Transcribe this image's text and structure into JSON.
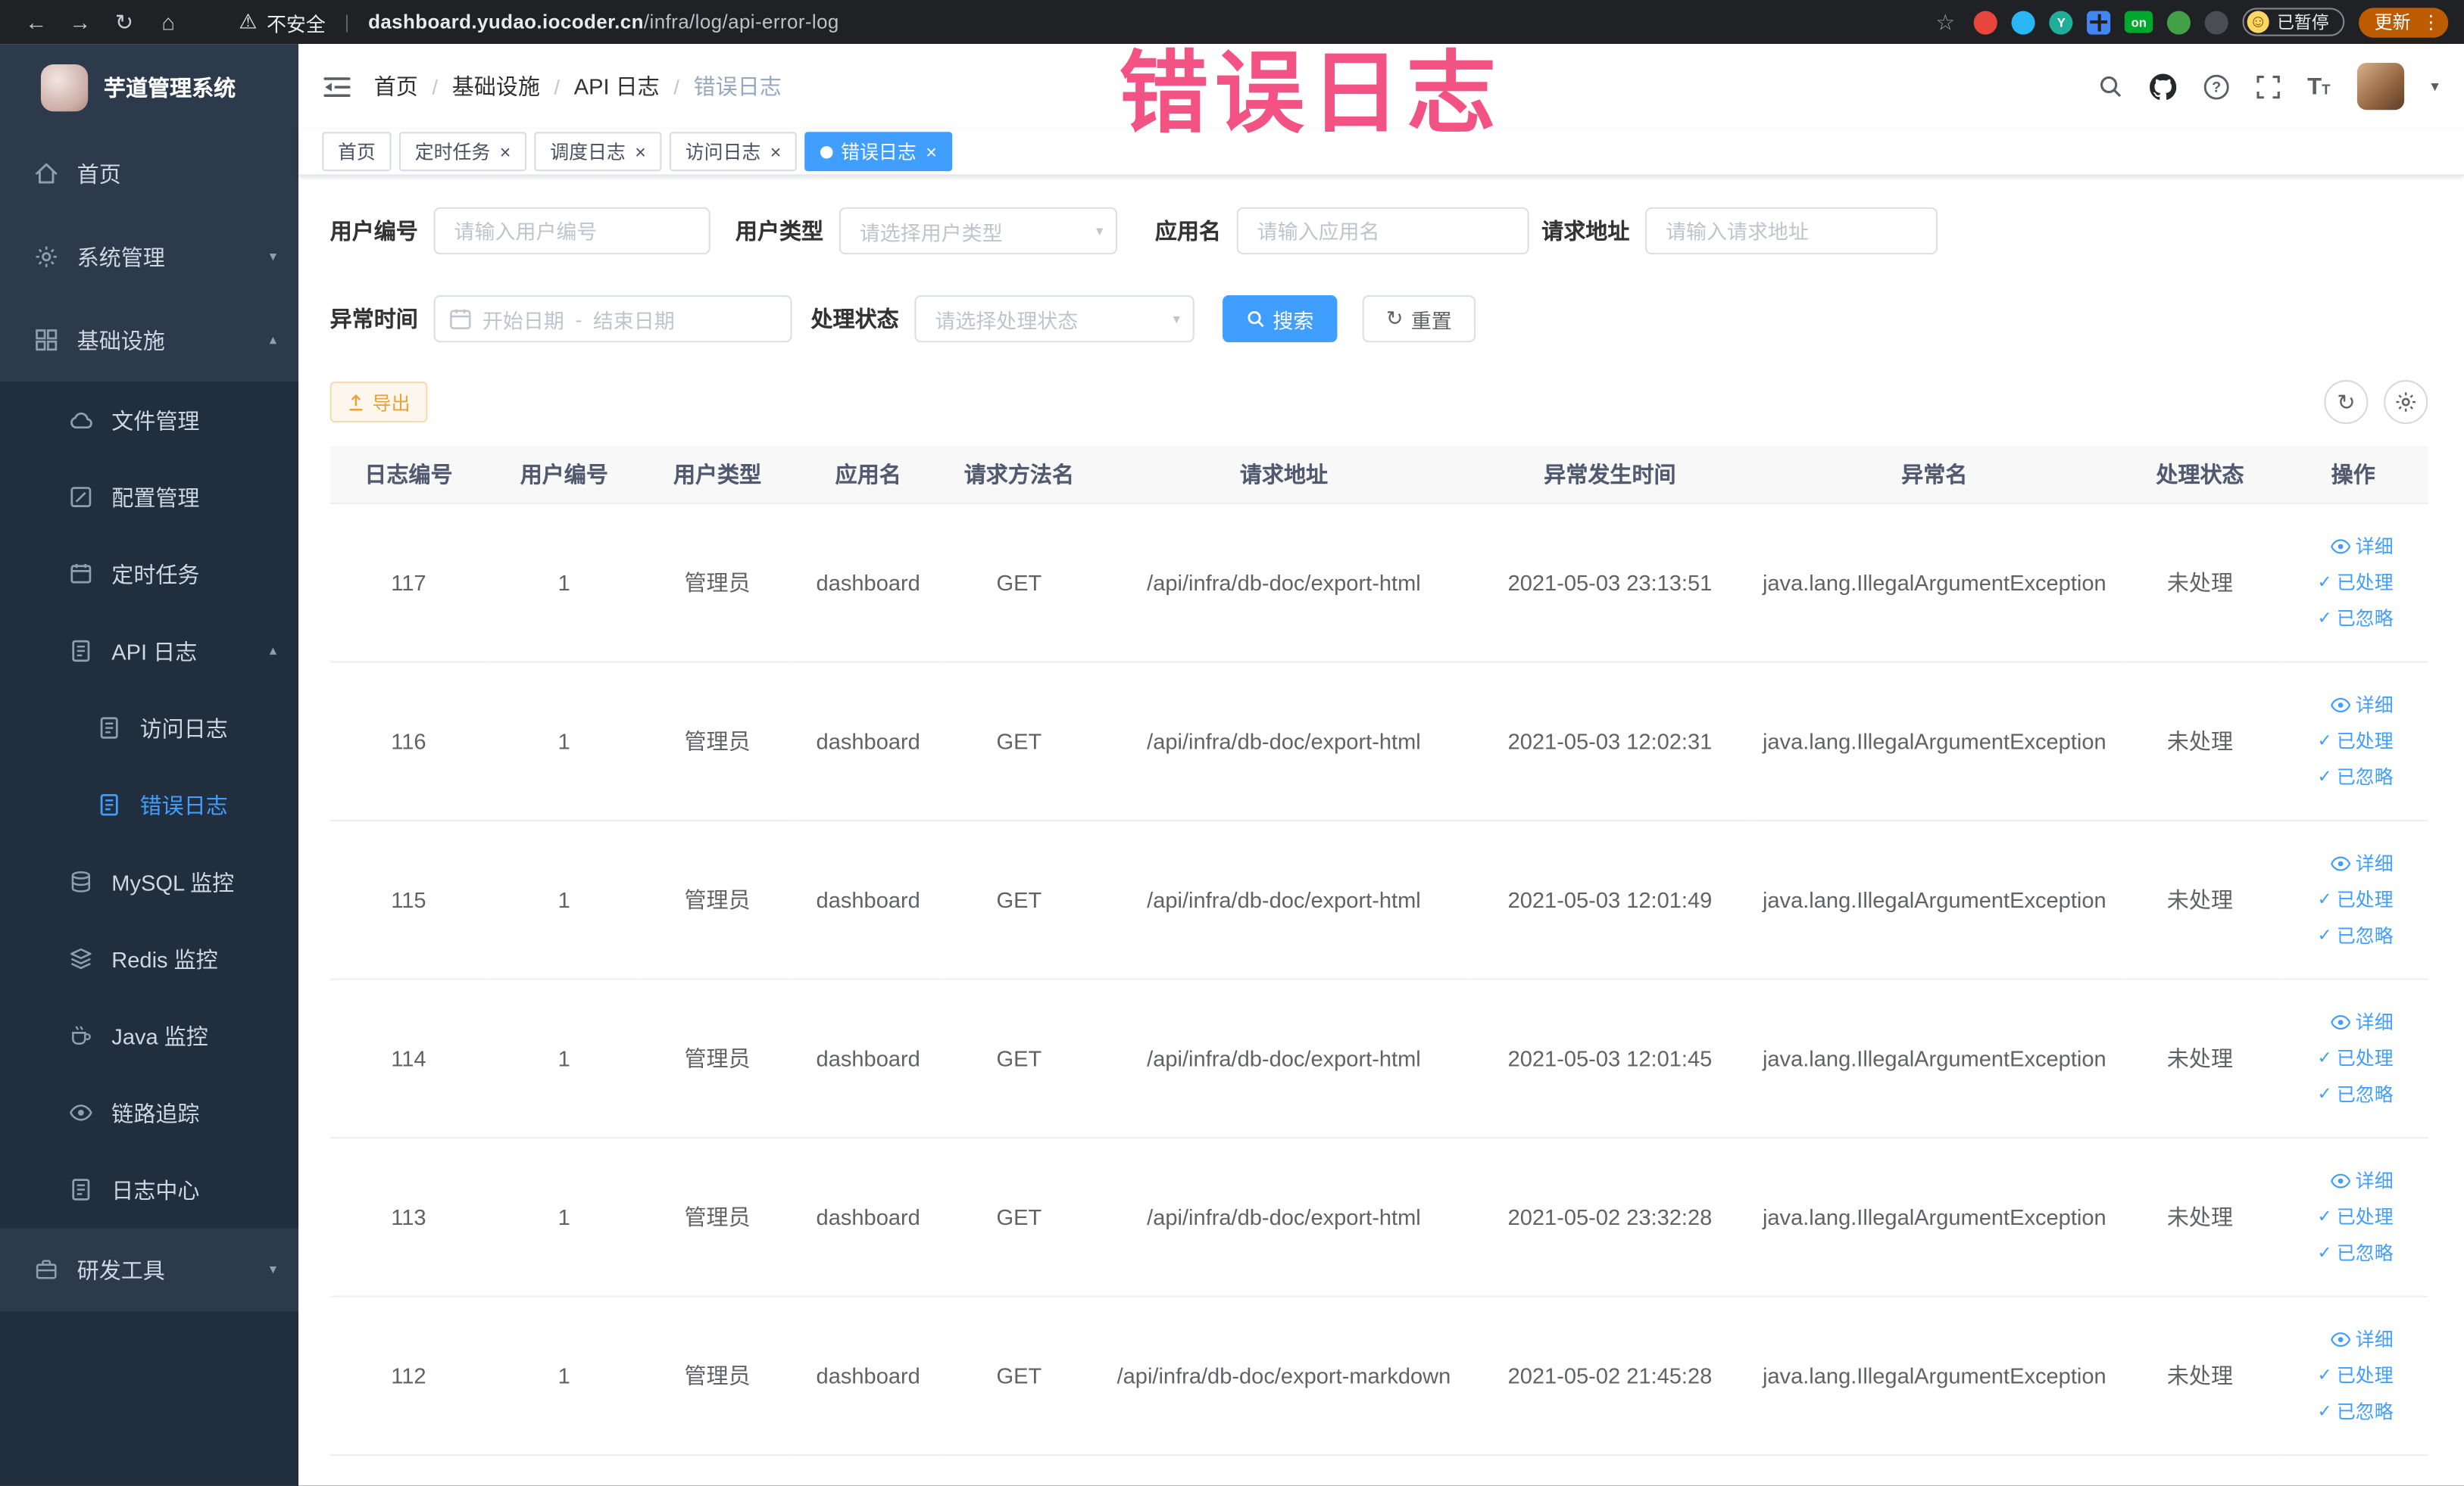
{
  "browser": {
    "security_label": "不安全",
    "url_domain": "dashboard.yudao.iocoder.cn",
    "url_path": "/infra/log/api-error-log",
    "ext_on_badge": "on",
    "paused_badge": "已暂停",
    "update_button": "更新"
  },
  "watermark": "错误日志",
  "sidebar": {
    "app_title": "芋道管理系统",
    "items": [
      {
        "label": "首页"
      },
      {
        "label": "系统管理"
      },
      {
        "label": "基础设施"
      },
      {
        "label": "文件管理"
      },
      {
        "label": "配置管理"
      },
      {
        "label": "定时任务"
      },
      {
        "label": "API 日志"
      },
      {
        "label": "访问日志"
      },
      {
        "label": "错误日志"
      },
      {
        "label": "MySQL 监控"
      },
      {
        "label": "Redis 监控"
      },
      {
        "label": "Java 监控"
      },
      {
        "label": "链路追踪"
      },
      {
        "label": "日志中心"
      },
      {
        "label": "研发工具"
      }
    ]
  },
  "header": {
    "breadcrumb": [
      {
        "label": "首页"
      },
      {
        "label": "基础设施"
      },
      {
        "label": "API 日志"
      },
      {
        "label": "错误日志"
      }
    ]
  },
  "tabs": [
    {
      "label": "首页"
    },
    {
      "label": "定时任务"
    },
    {
      "label": "调度日志"
    },
    {
      "label": "访问日志"
    },
    {
      "label": "错误日志"
    }
  ],
  "filters": {
    "user_id_label": "用户编号",
    "user_id_placeholder": "请输入用户编号",
    "user_type_label": "用户类型",
    "user_type_placeholder": "请选择用户类型",
    "app_name_label": "应用名",
    "app_name_placeholder": "请输入应用名",
    "request_url_label": "请求地址",
    "request_url_placeholder": "请输入请求地址",
    "exception_time_label": "异常时间",
    "date_start_placeholder": "开始日期",
    "date_separator": "-",
    "date_end_placeholder": "结束日期",
    "process_status_label": "处理状态",
    "process_status_placeholder": "请选择处理状态",
    "search_button": "搜索",
    "reset_button": "重置"
  },
  "toolbar": {
    "export_button": "导出"
  },
  "table": {
    "headers": [
      "日志编号",
      "用户编号",
      "用户类型",
      "应用名",
      "请求方法名",
      "请求地址",
      "异常发生时间",
      "异常名",
      "处理状态",
      "操作"
    ],
    "action_labels": {
      "detail": "详细",
      "processed": "已处理",
      "ignore": "已忽略"
    },
    "rows": [
      {
        "log_id": "117",
        "user_id": "1",
        "user_type": "管理员",
        "app_name": "dashboard",
        "method": "GET",
        "request_url": "/api/infra/db-doc/export-html",
        "exception_time": "2021-05-03 23:13:51",
        "exception_name": "java.lang.IllegalArgumentException",
        "status": "未处理"
      },
      {
        "log_id": "116",
        "user_id": "1",
        "user_type": "管理员",
        "app_name": "dashboard",
        "method": "GET",
        "request_url": "/api/infra/db-doc/export-html",
        "exception_time": "2021-05-03 12:02:31",
        "exception_name": "java.lang.IllegalArgumentException",
        "status": "未处理"
      },
      {
        "log_id": "115",
        "user_id": "1",
        "user_type": "管理员",
        "app_name": "dashboard",
        "method": "GET",
        "request_url": "/api/infra/db-doc/export-html",
        "exception_time": "2021-05-03 12:01:49",
        "exception_name": "java.lang.IllegalArgumentException",
        "status": "未处理"
      },
      {
        "log_id": "114",
        "user_id": "1",
        "user_type": "管理员",
        "app_name": "dashboard",
        "method": "GET",
        "request_url": "/api/infra/db-doc/export-html",
        "exception_time": "2021-05-03 12:01:45",
        "exception_name": "java.lang.IllegalArgumentException",
        "status": "未处理"
      },
      {
        "log_id": "113",
        "user_id": "1",
        "user_type": "管理员",
        "app_name": "dashboard",
        "method": "GET",
        "request_url": "/api/infra/db-doc/export-html",
        "exception_time": "2021-05-02 23:32:28",
        "exception_name": "java.lang.IllegalArgumentException",
        "status": "未处理"
      },
      {
        "log_id": "112",
        "user_id": "1",
        "user_type": "管理员",
        "app_name": "dashboard",
        "method": "GET",
        "request_url": "/api/infra/db-doc/export-markdown",
        "exception_time": "2021-05-02 21:45:28",
        "exception_name": "java.lang.IllegalArgumentException",
        "status": "未处理"
      }
    ]
  }
}
